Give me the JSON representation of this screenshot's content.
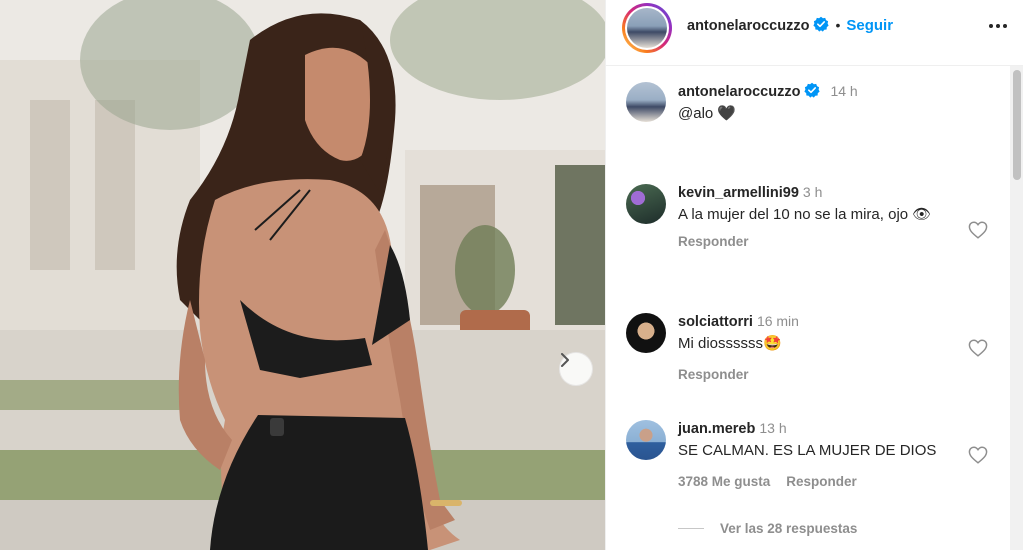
{
  "post": {
    "username": "antonelaroccuzzo",
    "follow_label": "Seguir",
    "separator": "•"
  },
  "caption": {
    "username": "antonelaroccuzzo",
    "time": "14 h",
    "text": "@alo 🖤"
  },
  "comments": [
    {
      "username": "kevin_armellini99",
      "time": "3 h",
      "text": "A la mujer del 10 no se la mira, ojo 👁",
      "likes": "",
      "reply_label": "Responder"
    },
    {
      "username": "solciattorri",
      "time": "16 min",
      "text": "Mi diossssss🤩",
      "likes": "",
      "reply_label": "Responder"
    },
    {
      "username": "juan.mereb",
      "time": "13 h",
      "text": "SE CALMAN. ES LA MUJER DE DIOS",
      "likes": "3788 Me gusta",
      "reply_label": "Responder"
    }
  ],
  "view_replies": "Ver las 28 respuestas",
  "colors": {
    "accent": "#0095f6",
    "verified": "#0095f6",
    "muted": "#8e8e8e",
    "text": "#262626"
  },
  "icons": [
    "verified-badge-icon",
    "more-options-icon",
    "heart-icon",
    "chevron-right-icon"
  ]
}
